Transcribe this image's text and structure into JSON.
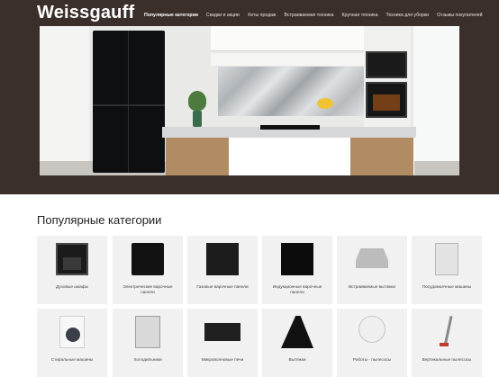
{
  "brand": {
    "logo_text": "Weissgauff"
  },
  "nav": {
    "items": [
      {
        "label": "Популярные категории",
        "active": true
      },
      {
        "label": "Скидки и акции",
        "active": false
      },
      {
        "label": "Хиты продаж",
        "active": false
      },
      {
        "label": "Встраиваемая техника",
        "active": false
      },
      {
        "label": "Крупная техника",
        "active": false
      },
      {
        "label": "Техника для уборки",
        "active": false
      },
      {
        "label": "Отзывы покупателей",
        "active": false
      }
    ]
  },
  "hero": {
    "image": "kitchen-banner"
  },
  "categories": {
    "title": "Популярные категории",
    "items": [
      {
        "label": "Духовые шкафы",
        "icon": "oven-icon"
      },
      {
        "label": "Электрические варочные панели",
        "icon": "electric-hob-icon"
      },
      {
        "label": "Газовые варочные панели",
        "icon": "gas-hob-icon"
      },
      {
        "label": "Индукционные варочные панели",
        "icon": "induction-hob-icon"
      },
      {
        "label": "Встраиваемые вытяжки",
        "icon": "built-in-hood-icon"
      },
      {
        "label": "Посудомоечные машины",
        "icon": "dishwasher-icon"
      },
      {
        "label": "Стиральные машины",
        "icon": "washing-machine-icon"
      },
      {
        "label": "Холодильники",
        "icon": "fridge-icon"
      },
      {
        "label": "Микроволновые печи",
        "icon": "microwave-icon"
      },
      {
        "label": "Вытяжки",
        "icon": "hood-icon"
      },
      {
        "label": "Роботы - пылесосы",
        "icon": "robot-vacuum-icon"
      },
      {
        "label": "Вертикальные пылесосы",
        "icon": "stick-vacuum-icon"
      }
    ]
  },
  "colors": {
    "header_bg": "#3b2f2b",
    "card_bg": "#f1f1f1",
    "text": "#222222"
  }
}
